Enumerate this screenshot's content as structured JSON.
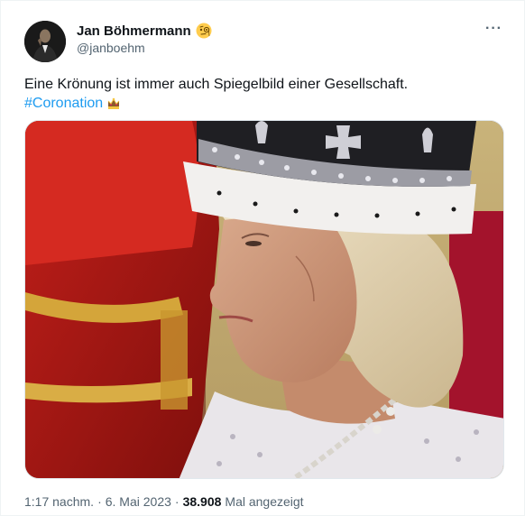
{
  "author": {
    "name": "Jan Böhmermann",
    "handle": "@janboehm",
    "name_emoji": "face-with-monocle-icon"
  },
  "tweet": {
    "text": "Eine Krönung ist immer auch Spiegelbild einer Gesellschaft.",
    "hashtag": "#Coronation",
    "hashtag_emoji": "crown-icon"
  },
  "meta": {
    "time": "1:17 nachm.",
    "separator1": "·",
    "date": "6. Mai 2023",
    "separator2": "·",
    "views_count": "38.908",
    "views_label": "Mal angezeigt"
  },
  "more_label": "···",
  "colors": {
    "link": "#1d9bf0",
    "secondary_text": "#536471",
    "primary_text": "#0f1419"
  }
}
